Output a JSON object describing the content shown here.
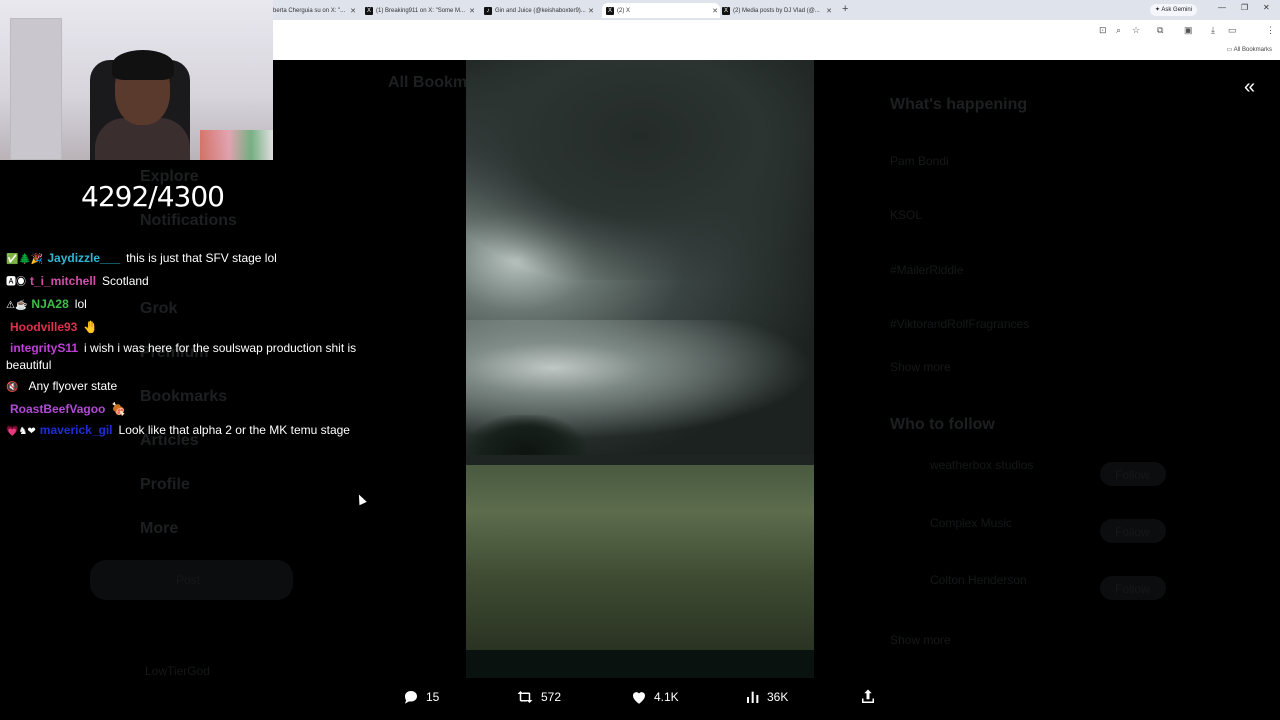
{
  "browser": {
    "tabs": [
      {
        "title": "berta Cherguia su on X: \"..."
      },
      {
        "title": "(1) Breaking911 on X: \"Some M..."
      },
      {
        "title": "Gin and Juice (@keishaboxter9)..."
      },
      {
        "title": "(2) X"
      },
      {
        "title": "(2) Media posts by DJ Vlad (@..."
      }
    ],
    "new_tab": "+",
    "gemini_label": "Ask Gemini",
    "all_bookmarks": "All Bookmarks"
  },
  "stream": {
    "counter": "4292/4300",
    "chat": [
      {
        "badges": "✅🌲🎉",
        "user": "Jaydizzle___",
        "user_color": "#2fb7d6",
        "text": "this is just that SFV stage lol"
      },
      {
        "badges": "🅰◉",
        "user": "t_i_mitchell",
        "user_color": "#d64dab",
        "text": "Scotland"
      },
      {
        "badges": "⚠☕",
        "user": "NJA28",
        "user_color": "#3fbf4a",
        "text": "lol"
      },
      {
        "badges": "",
        "user": "Hoodville93",
        "user_color": "#e0314a",
        "text": "🤚"
      },
      {
        "badges": "",
        "user": "integrityS11",
        "user_color": "#c03fd8",
        "text": "i wish i was here for the soulswap production shit is beautiful"
      },
      {
        "badges": "🔇",
        "user": "",
        "user_color": "#ffffff",
        "text": "Any flyover state"
      },
      {
        "badges": "",
        "user": "RoastBeefVagoo",
        "user_color": "#b04bd6",
        "text": "🍖"
      },
      {
        "badges": "💗♞❤",
        "user": "maverick_gil",
        "user_color": "#1e2dd8",
        "text": "Look like that alpha 2 or the MK temu stage"
      }
    ]
  },
  "background_page": {
    "nav": [
      "Explore",
      "Notifications",
      "Grok",
      "Premium",
      "Bookmarks",
      "Articles",
      "Profile",
      "More"
    ],
    "post_button": "Post",
    "header": "All Bookmarks",
    "whats_happening": "What's happening",
    "trends": [
      "Pam Bondi",
      "KSOL",
      "#MailerRiddle",
      "#ViktorandRolfFragrances"
    ],
    "show_more": "Show more",
    "who_to_follow": "Who to follow",
    "suggestions": [
      "weatherbox studios",
      "Complex Music",
      "Colton Henderson"
    ],
    "follow_label": "Follow",
    "account_name": "LowTierGod"
  },
  "post_actions": {
    "replies": "15",
    "reposts": "572",
    "likes": "4.1K",
    "views": "36K"
  },
  "colors": {
    "background": "#000000",
    "text": "#ffffff"
  }
}
